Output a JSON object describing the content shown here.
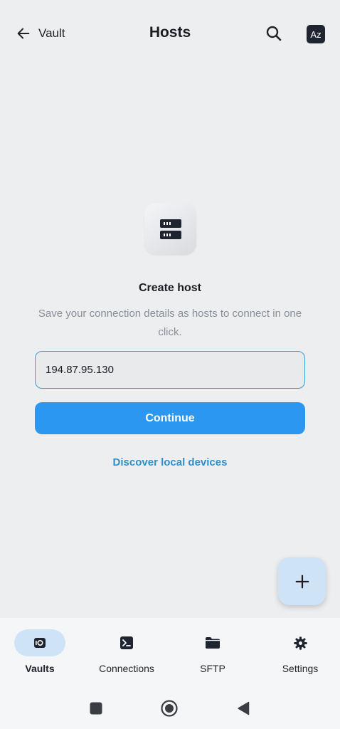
{
  "header": {
    "back_label": "Vault",
    "title": "Hosts",
    "sort_label": "Az",
    "back_icon": "arrow-left-icon",
    "search_icon": "search-icon"
  },
  "empty_state": {
    "icon": "server-icon",
    "title": "Create host",
    "description": "Save your connection details as hosts to connect in one click.",
    "input_value": "194.87.95.130",
    "continue_label": "Continue",
    "discover_label": "Discover local devices"
  },
  "fab": {
    "icon": "plus-icon"
  },
  "bottom_nav": {
    "items": [
      {
        "label": "Vaults",
        "icon": "vault-icon",
        "active": true
      },
      {
        "label": "Connections",
        "icon": "terminal-icon",
        "active": false
      },
      {
        "label": "SFTP",
        "icon": "folder-icon",
        "active": false
      },
      {
        "label": "Settings",
        "icon": "gear-icon",
        "active": false
      }
    ]
  },
  "colors": {
    "accent": "#2b97f0",
    "link": "#2f8fc9",
    "background": "#eceef0",
    "active_pill": "#cfe3f7"
  }
}
